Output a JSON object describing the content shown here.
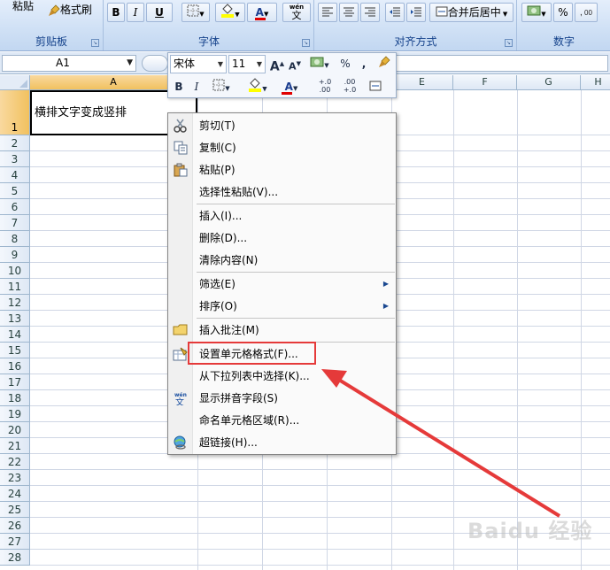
{
  "ribbon": {
    "clipboard": {
      "paste_label": "粘贴",
      "format_painter_label": "格式刷",
      "group_label": "剪贴板"
    },
    "font": {
      "bold": "B",
      "italic": "I",
      "underline": "U",
      "font_color_letter": "A",
      "phonetic_label": "wén",
      "phonetic_char": "文",
      "group_label": "字体"
    },
    "alignment": {
      "merge_label": "合并后居中",
      "group_label": "对齐方式"
    },
    "number": {
      "percent": "%",
      "group_label": "数字"
    }
  },
  "formula_bar": {
    "name_box": "A1",
    "formula_value": ""
  },
  "sheet": {
    "columns": [
      "A",
      "E",
      "F",
      "G",
      "H"
    ],
    "rows": [
      "1",
      "2",
      "3",
      "4",
      "5",
      "6",
      "7",
      "8",
      "9",
      "10",
      "11",
      "12",
      "13",
      "14",
      "15",
      "16",
      "17",
      "18",
      "19",
      "20",
      "21",
      "22",
      "23",
      "24",
      "25",
      "26",
      "27",
      "28"
    ],
    "a1_text": "横排文字变成竖排"
  },
  "mini_toolbar": {
    "font_name": "宋体",
    "font_size": "11",
    "grow": "A",
    "shrink": "A",
    "percent": "%",
    "comma": ",",
    "bold": "B",
    "italic": "I",
    "font_color_letter": "A",
    "inc_decimal": "+.0 .00",
    "dec_decimal": ".00 +.0"
  },
  "context_menu": {
    "items": [
      {
        "label": "剪切(T)",
        "icon": "scissors-icon"
      },
      {
        "label": "复制(C)",
        "icon": "copy-icon"
      },
      {
        "label": "粘贴(P)",
        "icon": "paste-icon"
      },
      {
        "label": "选择性粘贴(V)..."
      },
      {
        "label": "插入(I)..."
      },
      {
        "label": "删除(D)..."
      },
      {
        "label": "清除内容(N)"
      },
      {
        "label": "筛选(E)",
        "submenu": true
      },
      {
        "label": "排序(O)",
        "submenu": true
      },
      {
        "label": "插入批注(M)",
        "icon": "comment-icon"
      },
      {
        "label": "设置单元格格式(F)...",
        "icon": "format-cells-icon"
      },
      {
        "label": "从下拉列表中选择(K)..."
      },
      {
        "label": "显示拼音字段(S)",
        "icon": "phonetic-icon"
      },
      {
        "label": "命名单元格区域(R)..."
      },
      {
        "label": "超链接(H)...",
        "icon": "hyperlink-icon"
      }
    ],
    "submenu_arrow": "▶"
  },
  "watermark": "Baidu 经验",
  "colors": {
    "highlight": "#e53a3a",
    "arrow": "#e53a3a"
  }
}
